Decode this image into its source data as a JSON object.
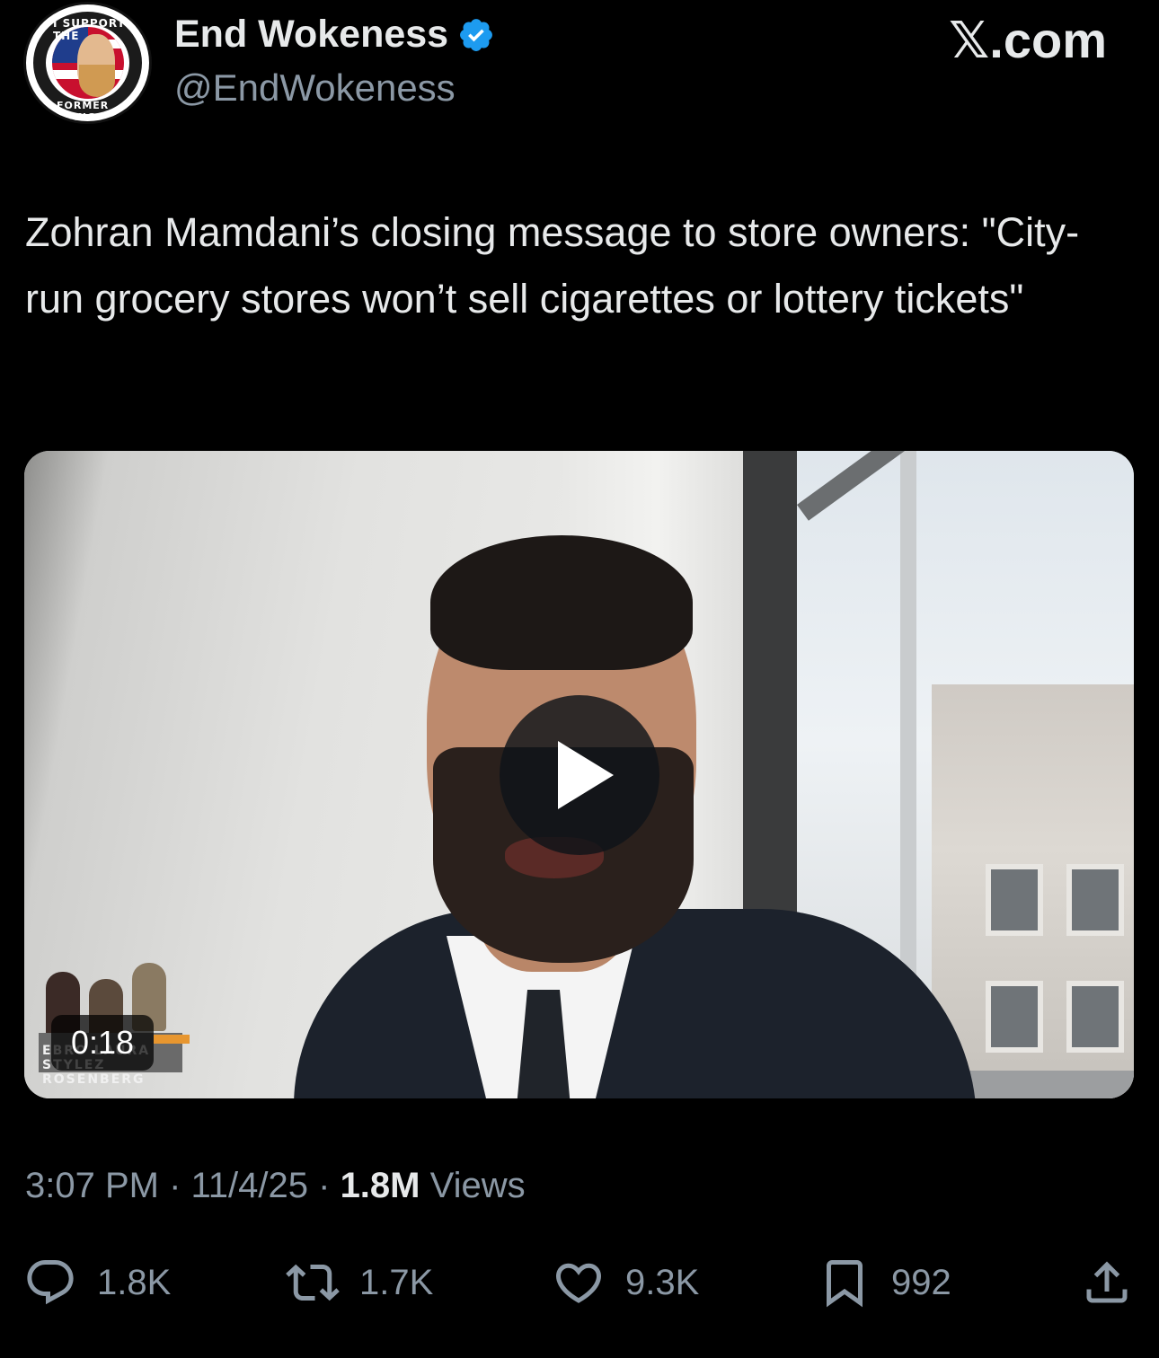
{
  "author": {
    "display_name": "End Wokeness",
    "handle": "@EndWokeness",
    "verified": true,
    "avatar_text_top": "I SUPPORT THE",
    "avatar_text_bottom": "FORMER THING"
  },
  "brand": "𝕏.com",
  "tweet": {
    "text": "Zohran Mamdani’s closing message to store owners: \"City-run grocery stores won’t sell cigarettes or lottery tickets\""
  },
  "media": {
    "type": "video",
    "duration": "0:18",
    "overlay_text": "EBRO LAURA STYLEZ ROSENBERG"
  },
  "meta": {
    "time": "3:07 PM",
    "sep1": " · ",
    "date": "11/4/25",
    "sep2": " · ",
    "views_count": "1.8M",
    "views_label": " Views"
  },
  "actions": {
    "reply": {
      "icon": "reply-icon",
      "count": "1.8K"
    },
    "repost": {
      "icon": "repost-icon",
      "count": "1.7K"
    },
    "like": {
      "icon": "heart-icon",
      "count": "9.3K"
    },
    "bookmark": {
      "icon": "bookmark-icon",
      "count": "992"
    },
    "share": {
      "icon": "share-icon"
    }
  },
  "colors": {
    "background": "#000000",
    "text_primary": "#e7e9ea",
    "text_secondary": "#8b98a5",
    "verified": "#1d9bf0"
  }
}
